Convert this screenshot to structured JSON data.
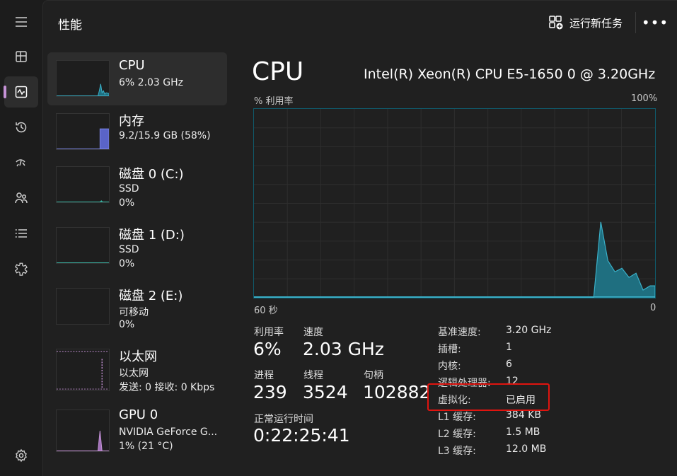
{
  "nav": {
    "items": [
      {
        "icon": "hamburger-icon"
      },
      {
        "icon": "processes-icon"
      },
      {
        "icon": "performance-icon",
        "active": true
      },
      {
        "icon": "app-history-icon"
      },
      {
        "icon": "startup-apps-icon"
      },
      {
        "icon": "users-icon"
      },
      {
        "icon": "details-icon"
      },
      {
        "icon": "services-icon"
      }
    ],
    "settings_icon": "gear-icon"
  },
  "header": {
    "title": "性能",
    "run_task_label": "运行新任务",
    "more": "•••"
  },
  "sidebar": {
    "cards": [
      {
        "title": "CPU",
        "lines": [
          "6% 2.03 GHz"
        ],
        "color": "#3ab0c8",
        "selected": true
      },
      {
        "title": "内存",
        "lines": [
          "9.2/15.9 GB (58%)"
        ],
        "color": "#7a84e0"
      },
      {
        "title": "磁盘 0 (C:)",
        "lines": [
          "SSD",
          "0%"
        ],
        "color": "#3ab0a0"
      },
      {
        "title": "磁盘 1 (D:)",
        "lines": [
          "SSD",
          "0%"
        ],
        "color": "#3ab0a0"
      },
      {
        "title": "磁盘 2 (E:)",
        "lines": [
          "可移动",
          "0%"
        ],
        "color": "#3ab0a0"
      },
      {
        "title": "以太网",
        "lines": [
          "以太网",
          "发送: 0 接收: 0 Kbps"
        ],
        "color": "#c592d6"
      },
      {
        "title": "GPU 0",
        "lines": [
          "NVIDIA GeForce G...",
          "1% (21 °C)"
        ],
        "color": "#c592d6"
      }
    ]
  },
  "detail": {
    "title": "CPU",
    "model": "Intel(R) Xeon(R) CPU E5-1650 0 @ 3.20GHz",
    "y_axis_label": "% 利用率",
    "y_max_label": "100%",
    "x_left_label": "60 秒",
    "x_right_label": "0",
    "graph_color": "#3ab0c8",
    "stats": {
      "utilization_label": "利用率",
      "utilization_value": "6%",
      "speed_label": "速度",
      "speed_value": "2.03 GHz",
      "processes_label": "进程",
      "processes_value": "239",
      "threads_label": "线程",
      "threads_value": "3524",
      "handles_label": "句柄",
      "handles_value": "102882",
      "uptime_label": "正常运行时间",
      "uptime_value": "0:22:25:41"
    },
    "specs": [
      {
        "key": "基准速度:",
        "value": "3.20 GHz"
      },
      {
        "key": "插槽:",
        "value": "1"
      },
      {
        "key": "内核:",
        "value": "6"
      },
      {
        "key": "逻辑处理器:",
        "value": "12"
      },
      {
        "key": "虚拟化:",
        "value": "已启用"
      },
      {
        "key": "L1 缓存:",
        "value": "384 KB"
      },
      {
        "key": "L2 缓存:",
        "value": "1.5 MB"
      },
      {
        "key": "L3 缓存:",
        "value": "12.0 MB"
      }
    ],
    "highlight_color": "#e0140f"
  }
}
